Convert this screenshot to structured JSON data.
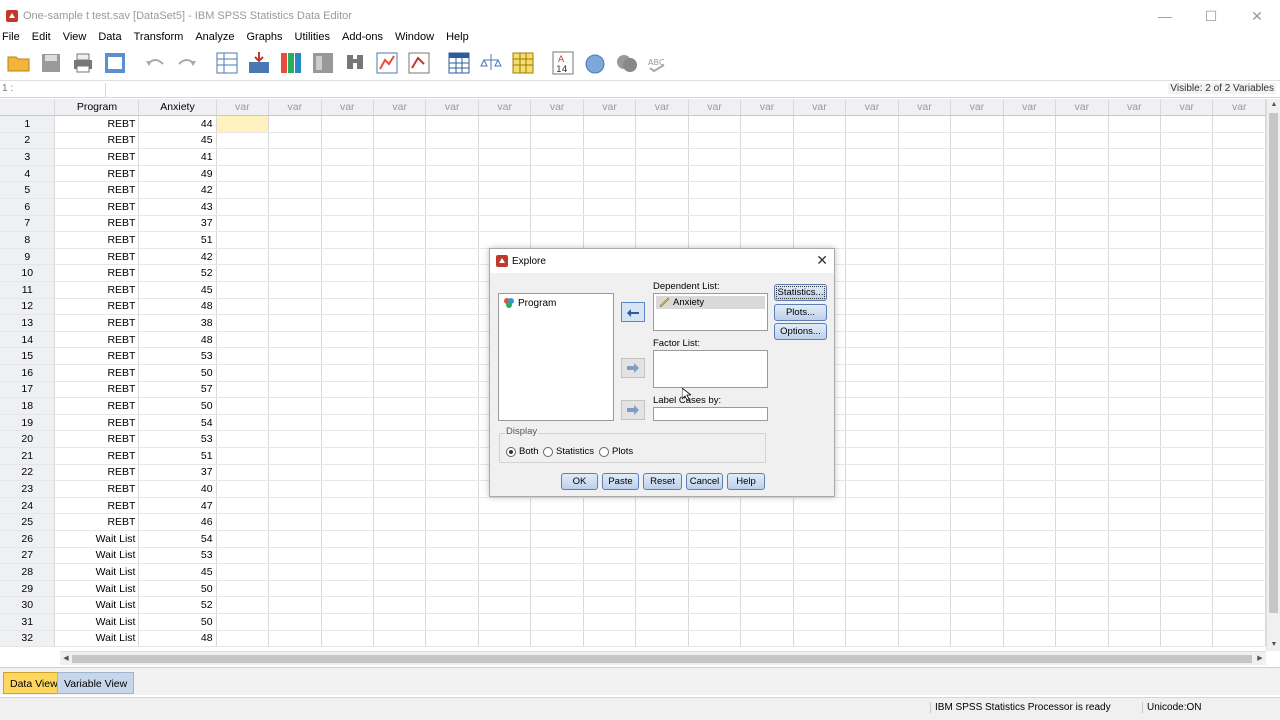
{
  "window": {
    "title": "One-sample t test.sav [DataSet5] - IBM SPSS Statistics Data Editor",
    "minimize": "—",
    "maximize": "☐",
    "close": "✕"
  },
  "menu": [
    "File",
    "Edit",
    "View",
    "Data",
    "Transform",
    "Analyze",
    "Graphs",
    "Utilities",
    "Add-ons",
    "Window",
    "Help"
  ],
  "cellbar": {
    "cell_ref": "1 :",
    "visible": "Visible: 2 of 2 Variables"
  },
  "grid": {
    "columns": [
      "Program",
      "Anxiety",
      "var",
      "var",
      "var",
      "var",
      "var",
      "var",
      "var",
      "var",
      "var",
      "var",
      "var",
      "var",
      "var",
      "var",
      "var",
      "var",
      "var",
      "var",
      "var",
      "var"
    ],
    "rows": [
      [
        "1",
        "REBT",
        "44"
      ],
      [
        "2",
        "REBT",
        "45"
      ],
      [
        "3",
        "REBT",
        "41"
      ],
      [
        "4",
        "REBT",
        "49"
      ],
      [
        "5",
        "REBT",
        "42"
      ],
      [
        "6",
        "REBT",
        "43"
      ],
      [
        "7",
        "REBT",
        "37"
      ],
      [
        "8",
        "REBT",
        "51"
      ],
      [
        "9",
        "REBT",
        "42"
      ],
      [
        "10",
        "REBT",
        "52"
      ],
      [
        "11",
        "REBT",
        "45"
      ],
      [
        "12",
        "REBT",
        "48"
      ],
      [
        "13",
        "REBT",
        "38"
      ],
      [
        "14",
        "REBT",
        "48"
      ],
      [
        "15",
        "REBT",
        "53"
      ],
      [
        "16",
        "REBT",
        "50"
      ],
      [
        "17",
        "REBT",
        "57"
      ],
      [
        "18",
        "REBT",
        "50"
      ],
      [
        "19",
        "REBT",
        "54"
      ],
      [
        "20",
        "REBT",
        "53"
      ],
      [
        "21",
        "REBT",
        "51"
      ],
      [
        "22",
        "REBT",
        "37"
      ],
      [
        "23",
        "REBT",
        "40"
      ],
      [
        "24",
        "REBT",
        "47"
      ],
      [
        "25",
        "REBT",
        "46"
      ],
      [
        "26",
        "Wait List",
        "54"
      ],
      [
        "27",
        "Wait List",
        "53"
      ],
      [
        "28",
        "Wait List",
        "45"
      ],
      [
        "29",
        "Wait List",
        "50"
      ],
      [
        "30",
        "Wait List",
        "52"
      ],
      [
        "31",
        "Wait List",
        "50"
      ],
      [
        "32",
        "Wait List",
        "48"
      ]
    ]
  },
  "tabs": {
    "data_view": "Data View",
    "variable_view": "Variable View"
  },
  "status": {
    "processor": "IBM SPSS Statistics Processor is ready",
    "unicode": "Unicode:ON"
  },
  "dialog": {
    "title": "Explore",
    "close": "✕",
    "source_items": [
      "Program"
    ],
    "dependent_label": "Dependent List:",
    "dependent_items": [
      "Anxiety"
    ],
    "factor_label": "Factor List:",
    "label_cases_label": "Label Cases by:",
    "side_buttons": {
      "statistics": "Statistics...",
      "plots": "Plots...",
      "options": "Options..."
    },
    "display": {
      "label": "Display",
      "both": "Both",
      "statistics": "Statistics",
      "plots": "Plots",
      "selected": "Both"
    },
    "buttons": {
      "ok": "OK",
      "paste": "Paste",
      "reset": "Reset",
      "cancel": "Cancel",
      "help": "Help"
    }
  },
  "colors": {
    "selected_cell": "#fff2bf",
    "active_tab": "#ffd75e",
    "button_border": "#5c7fb8"
  }
}
